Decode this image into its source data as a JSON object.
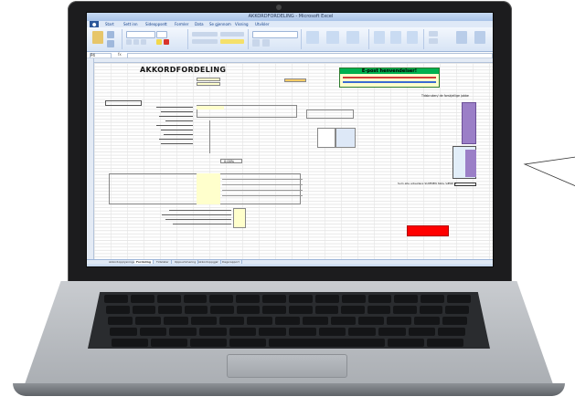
{
  "window": {
    "title": "AKKORDFORDELING - Microsoft Excel"
  },
  "ribbon": {
    "tabs": [
      "Start",
      "Sett inn",
      "Sideoppsett",
      "Formler",
      "Data",
      "Se gjennom",
      "Visning",
      "Utvikler"
    ]
  },
  "formula_bar": {
    "cell": "P4",
    "formula": ""
  },
  "sheet": {
    "title": "AKKORDFORDELING",
    "welcome": "E-post henvendelser!",
    "right_header": "Tidsbruken/ de forskjellige jobbe",
    "percent_value": "0,00%",
    "totals_label": "Sum alle arbeidere SUMMEN SKAL VÆRE 0",
    "value_zero": "0,00"
  },
  "sheet_tabs": [
    "Akkordopplysninger",
    "Fordeling",
    "Tidslister",
    "Oppsummering",
    "Akkordoppgjør",
    "Dagsrapport"
  ],
  "colors": {
    "accent_green": "#00b050",
    "alert_red": "#ff0000",
    "header_yellow": "#ffffcc",
    "purple": "#9b7fc7"
  }
}
